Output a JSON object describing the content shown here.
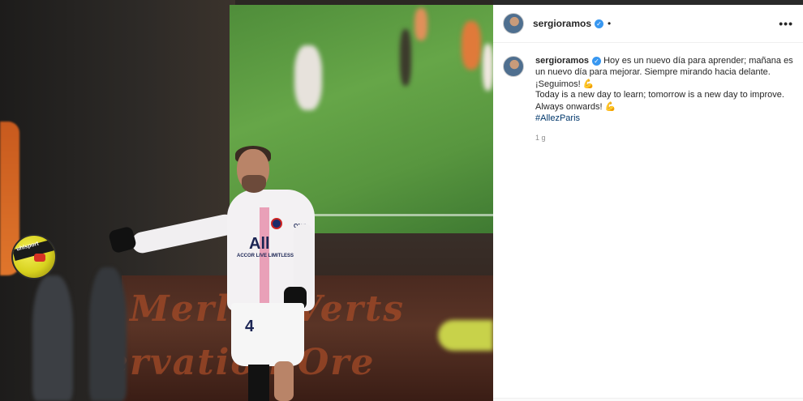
{
  "post": {
    "username": "sergioramos",
    "verified": true,
    "more_label": "•••",
    "dot_separator": "•",
    "caption_lines": [
      "Hoy es un nuevo día para aprender; mañana es",
      "un nuevo día para mejorar. Siempre mirando hacia delante.",
      "¡Seguimos! 💪",
      "Today is a new day to learn; tomorrow is a new day to improve.",
      "Always onwards! 💪"
    ],
    "caption_first_line": "Hoy es un nuevo día para aprender; mañana es",
    "caption_line2": "un nuevo día para mejorar. Siempre mirando hacia delante.",
    "caption_line3": "¡Seguimos!",
    "caption_line4": "Today is a new day to learn; tomorrow is a new day to improve.",
    "caption_line5": "Always onwards!",
    "emoji": "💪",
    "hashtag": "#AllezParis",
    "timestamp": "1 g"
  },
  "photo": {
    "jersey_sponsor": "All",
    "jersey_tagline": "ACCOR LIVE LIMITLESS",
    "jersey_brand": "QNE",
    "shirt_number": "4",
    "ball_brand": "uhlsport",
    "banner_text_1": "Merlus Verts",
    "banner_text_2": "ervation Ore"
  },
  "colors": {
    "link": "#00376b",
    "verified": "#3897f0",
    "text": "#262626",
    "muted": "#8e8e8e"
  }
}
